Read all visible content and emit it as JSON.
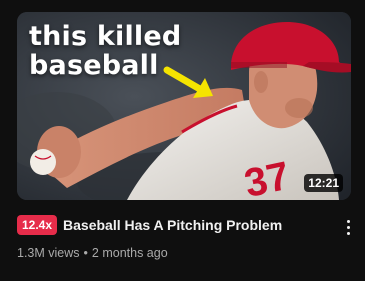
{
  "video": {
    "thumbnail_overlay": {
      "line1": "this killed",
      "line2": "baseball"
    },
    "duration": "12:21",
    "badge": "12.4x",
    "title": "Baseball Has A Pitching Problem",
    "views": "1.3M views",
    "separator": "•",
    "age": "2 months ago"
  },
  "icons": {
    "more": "more-vertical-icon",
    "arrow": "arrow-icon"
  },
  "colors": {
    "background": "#0f0f0f",
    "badge": "#e62c4a",
    "arrow": "#f5e400",
    "cap": "#c8102e",
    "secondary_text": "#aaaaaa"
  }
}
